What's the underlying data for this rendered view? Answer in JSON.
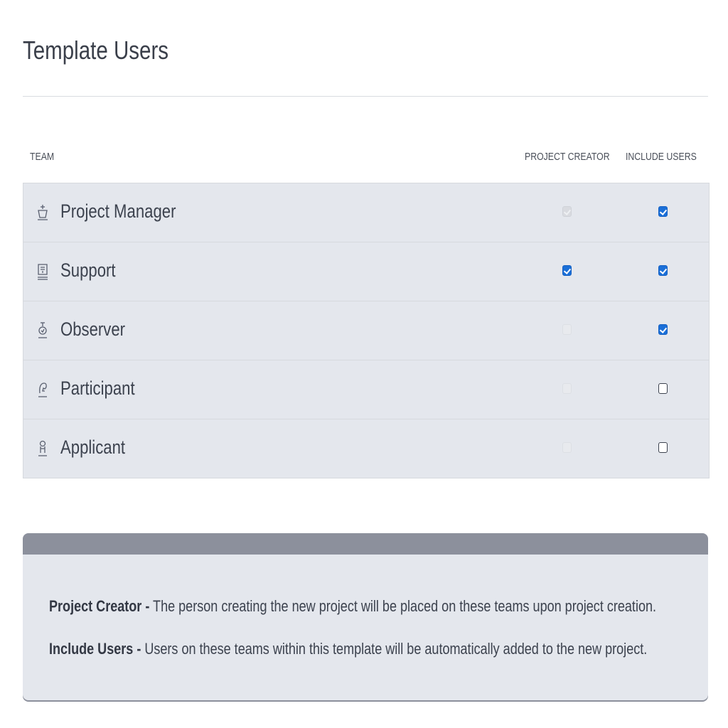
{
  "title": "Template Users",
  "table": {
    "headers": {
      "team": "TEAM",
      "project_creator": "PROJECT CREATOR",
      "include_users": "INCLUDE USERS"
    },
    "rows": [
      {
        "icon": "project-manager-icon",
        "label": "Project Manager",
        "project_creator": "checked-disabled",
        "include_users": "checked"
      },
      {
        "icon": "support-icon",
        "label": "Support",
        "project_creator": "checked",
        "include_users": "checked"
      },
      {
        "icon": "observer-icon",
        "label": "Observer",
        "project_creator": "disabled",
        "include_users": "checked"
      },
      {
        "icon": "participant-icon",
        "label": "Participant",
        "project_creator": "disabled",
        "include_users": "unchecked"
      },
      {
        "icon": "applicant-icon",
        "label": "Applicant",
        "project_creator": "disabled",
        "include_users": "unchecked"
      }
    ]
  },
  "info": {
    "line1_term": "Project Creator -",
    "line1_text": " The person creating the new project will be placed on these teams upon project creation.",
    "line2_term": "Include Users -",
    "line2_text": " Users on these teams within this template will be automatically added to the new project."
  },
  "colors": {
    "accent": "#1a6fd8",
    "row_bg": "#e4e7ed",
    "info_header": "#8c909c"
  }
}
